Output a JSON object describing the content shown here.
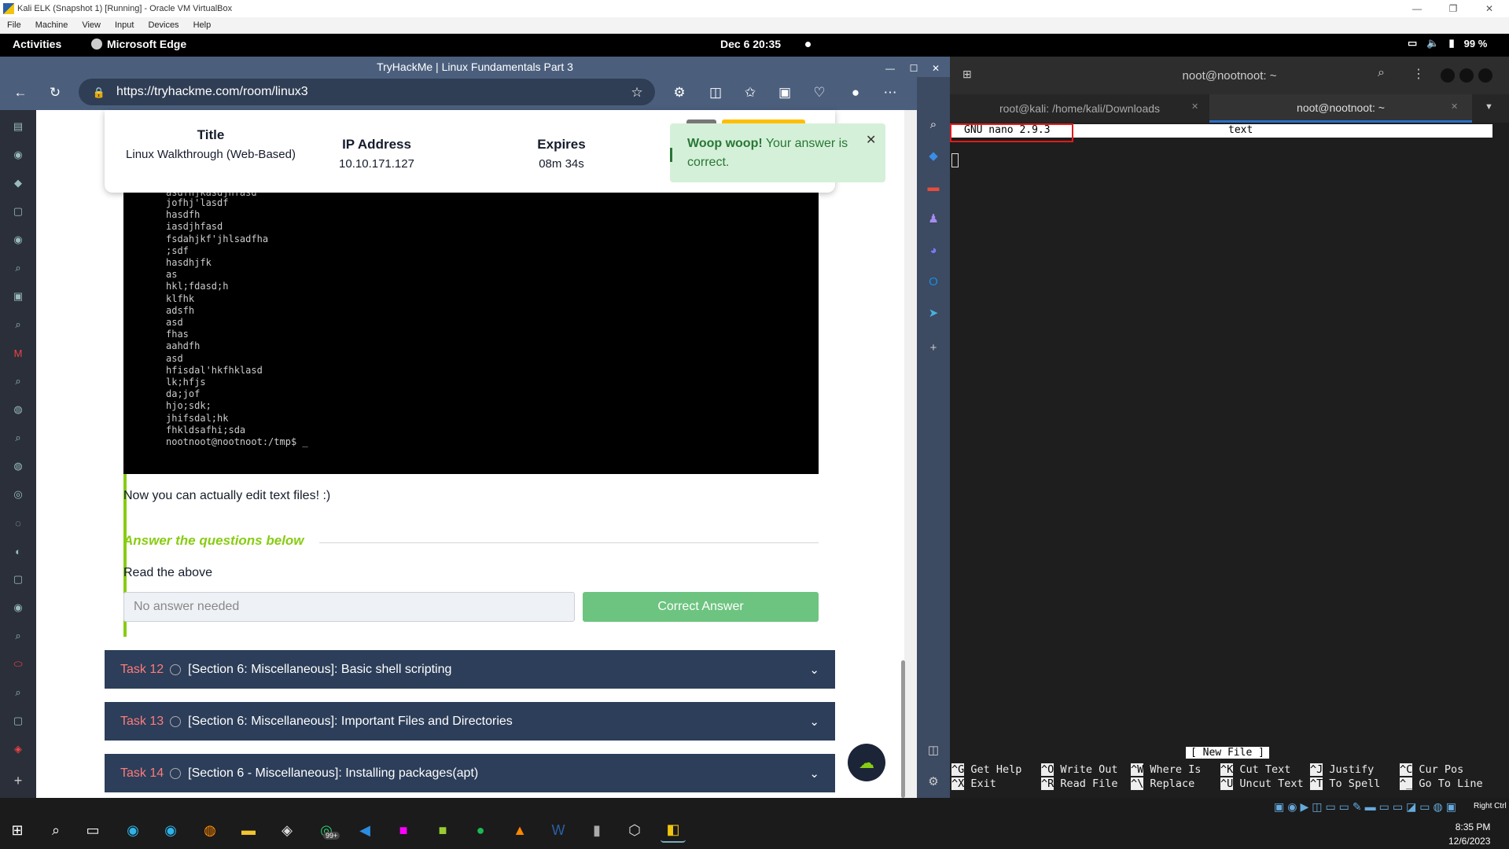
{
  "vbox": {
    "title": "Kali ELK (Snapshot 1) [Running] - Oracle VM VirtualBox",
    "menu": [
      "File",
      "Machine",
      "View",
      "Input",
      "Devices",
      "Help"
    ]
  },
  "gnome": {
    "activities": "Activities",
    "app": "Microsoft Edge",
    "clock": "Dec 6  20:35",
    "battery": "99 %"
  },
  "edge": {
    "title": "TryHackMe | Linux Fundamentals Part 3",
    "url": "https://tryhackme.com/room/linux3"
  },
  "machine": {
    "title_label": "Title",
    "title_value": "Linux Walkthrough (Web-Based)",
    "ip_label": "IP Address",
    "ip_value": "10.10.171.127",
    "expires_label": "Expires",
    "expires_value": "08m 34s"
  },
  "toast": {
    "bold": "Woop woop!",
    "text": " Your answer is correct."
  },
  "terminal": {
    "lines": [
      "asdfhjkasdjhfasd",
      "jofhj'lasdf",
      "hasdfh",
      "iasdjhfasd",
      "fsdahjkf'jhlsadfha",
      ";sdf",
      "hasdhjfk",
      "as",
      "hkl;fdasd;h",
      "klfhk",
      "adsfh",
      "asd",
      "fhas",
      "aahdfh",
      "asd",
      "hfisdal'hkfhklasd",
      "lk;hfjs",
      "da;jof",
      "hjo;sdk;",
      "jhifsdal;hk",
      "fhkldsafhi;sda",
      "nootnoot@nootnoot:/tmp$ _"
    ]
  },
  "content": {
    "paragraph": "Now you can actually edit text files! :)",
    "answer_heading": "Answer the questions below",
    "question": "Read the above",
    "answer_placeholder": "No answer needed",
    "correct_button": "Correct Answer"
  },
  "tasks": [
    {
      "num": "Task 12",
      "title": "[Section 6: Miscellaneous]: Basic shell scripting"
    },
    {
      "num": "Task 13",
      "title": "[Section 6: Miscellaneous]: Important Files and Directories"
    },
    {
      "num": "Task 14",
      "title": "[Section 6 - Miscellaneous]: Installing packages(apt)"
    }
  ],
  "kterm": {
    "title": "noot@nootnoot: ~",
    "tabs": [
      "root@kali: /home/kali/Downloads",
      "noot@nootnoot: ~"
    ],
    "nano_version": "GNU nano 2.9.3",
    "nano_file": "text",
    "new_file": "[ New File ]",
    "help_row1": [
      [
        "^G",
        "Get Help"
      ],
      [
        "^O",
        "Write Out"
      ],
      [
        "^W",
        "Where Is"
      ],
      [
        "^K",
        "Cut Text"
      ],
      [
        "^J",
        "Justify"
      ],
      [
        "^C",
        "Cur Pos"
      ]
    ],
    "help_row2": [
      [
        "^X",
        "Exit"
      ],
      [
        "^R",
        "Read File"
      ],
      [
        "^\\",
        "Replace"
      ],
      [
        "^U",
        "Uncut Text"
      ],
      [
        "^T",
        "To Spell"
      ],
      [
        "^_",
        "Go To Line"
      ]
    ]
  },
  "taskbar": {
    "time": "8:35 PM",
    "date": "12/6/2023",
    "right_ctrl": "Right Ctrl",
    "whatsapp_badge": "99+"
  }
}
